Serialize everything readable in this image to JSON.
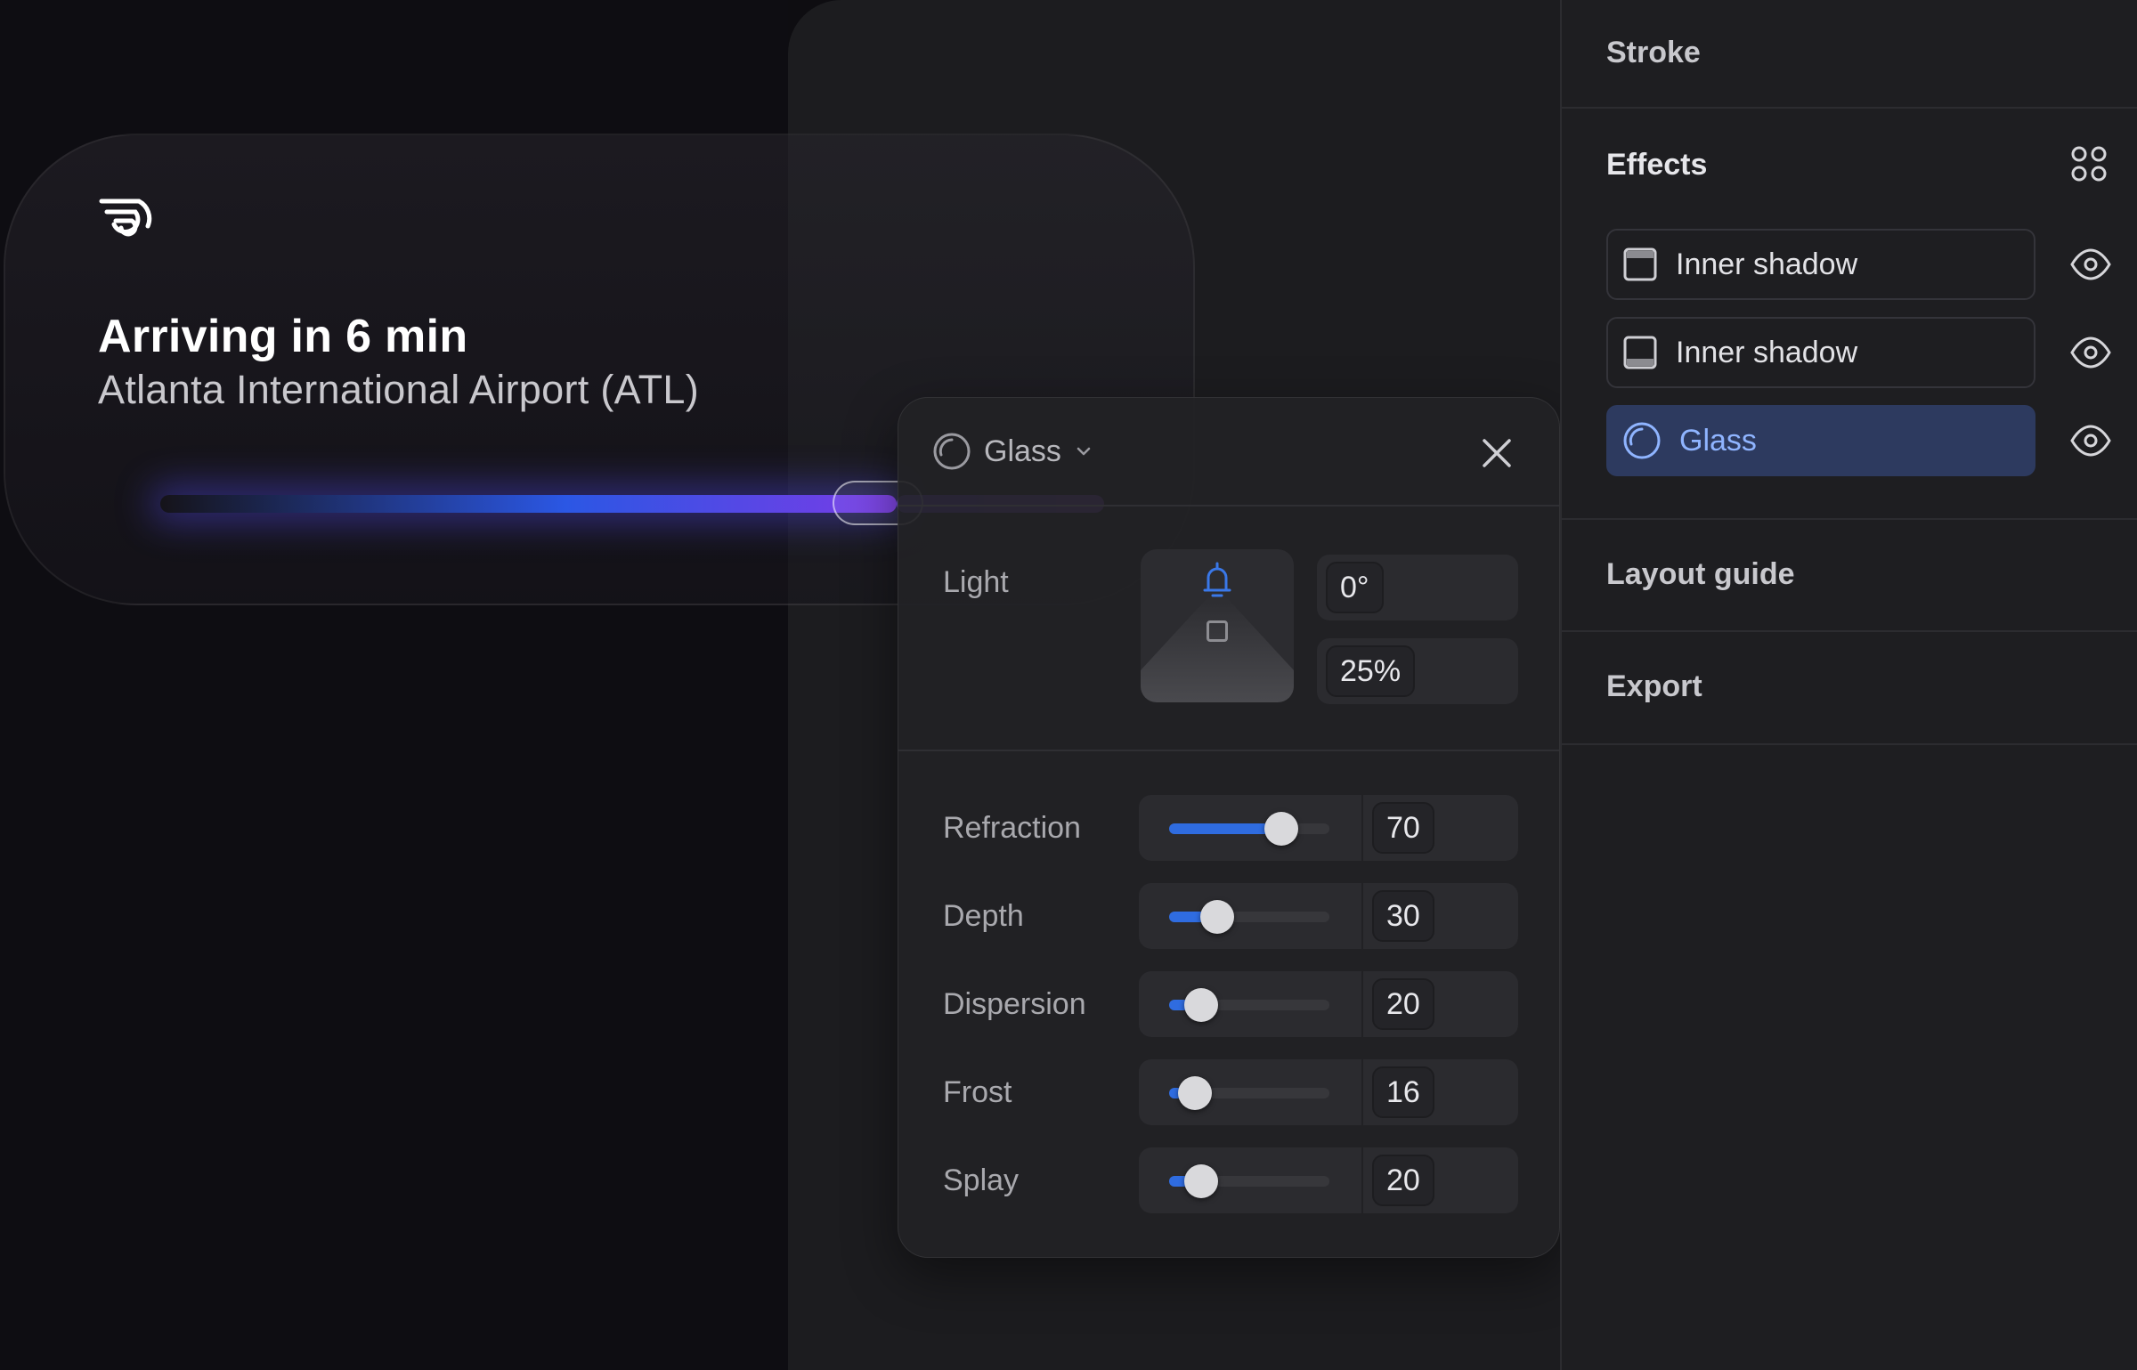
{
  "preview": {
    "title": "Arriving in 6 min",
    "subtitle": "Atlanta International Airport (ATL)",
    "progress_fraction": 0.78
  },
  "glass_popover": {
    "effect_type": "Glass",
    "light": {
      "label": "Light",
      "angle": "0°",
      "intensity": "25%"
    },
    "sliders": [
      {
        "label": "Refraction",
        "value": "70"
      },
      {
        "label": "Depth",
        "value": "30"
      },
      {
        "label": "Dispersion",
        "value": "20"
      },
      {
        "label": "Frost",
        "value": "16"
      },
      {
        "label": "Splay",
        "value": "20"
      }
    ]
  },
  "right_panel": {
    "stroke": "Stroke",
    "effects": "Effects",
    "effect_items": [
      {
        "label": "Inner shadow",
        "icon": "inner-shadow-top-icon"
      },
      {
        "label": "Inner shadow",
        "icon": "inner-shadow-bottom-icon"
      },
      {
        "label": "Glass",
        "icon": "glass-icon",
        "active": true
      }
    ],
    "layout_guide": "Layout guide",
    "export": "Export"
  },
  "colors": {
    "accent": "#2f6ce0",
    "active_effect_bg": "#2d3a5f",
    "active_effect_text": "#8fb4ff",
    "progress_end": "#8f52d4"
  }
}
